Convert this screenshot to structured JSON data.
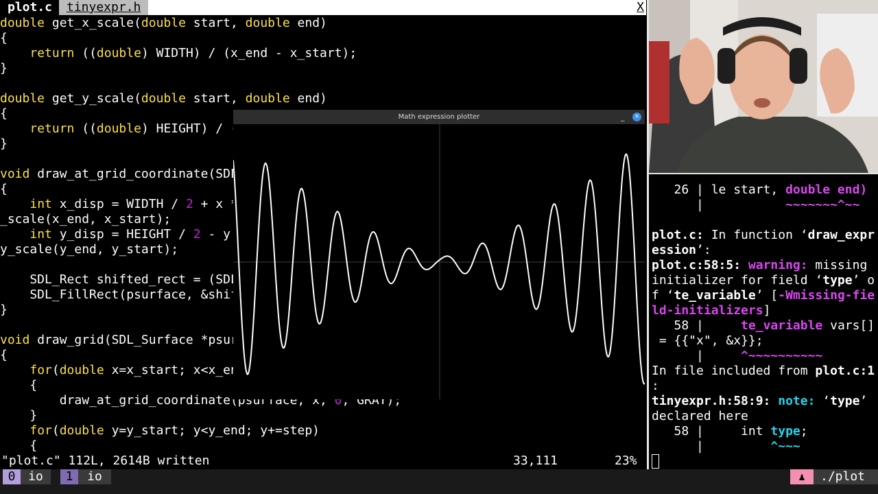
{
  "vim": {
    "tabs": [
      "plot.c",
      "tinyexpr.h"
    ],
    "close_label": "X",
    "code_lines": [
      [
        {
          "t": "double",
          "c": "kt"
        },
        {
          "t": " get_x_scale("
        },
        {
          "t": "double",
          "c": "kt"
        },
        {
          "t": " start, "
        },
        {
          "t": "double",
          "c": "kt"
        },
        {
          "t": " end)"
        }
      ],
      [
        {
          "t": "{"
        }
      ],
      [
        {
          "t": "    "
        },
        {
          "t": "return",
          "c": "kt"
        },
        {
          "t": " (("
        },
        {
          "t": "double",
          "c": "kt"
        },
        {
          "t": ") WIDTH) / (x_end - x_start);"
        }
      ],
      [
        {
          "t": "}"
        }
      ],
      [],
      [
        {
          "t": "double",
          "c": "kt"
        },
        {
          "t": " get_y_scale("
        },
        {
          "t": "double",
          "c": "kt"
        },
        {
          "t": " start, "
        },
        {
          "t": "double",
          "c": "kt"
        },
        {
          "t": " end)"
        }
      ],
      [
        {
          "t": "{"
        }
      ],
      [
        {
          "t": "    "
        },
        {
          "t": "return",
          "c": "kt"
        },
        {
          "t": " (("
        },
        {
          "t": "double",
          "c": "kt"
        },
        {
          "t": ") HEIGHT) / ("
        }
      ],
      [
        {
          "t": "}"
        }
      ],
      [],
      [
        {
          "t": "void",
          "c": "kt"
        },
        {
          "t": " draw_at_grid_coordinate(SDL"
        }
      ],
      [
        {
          "t": "{"
        }
      ],
      [
        {
          "t": "    "
        },
        {
          "t": "int",
          "c": "kt"
        },
        {
          "t": " x_disp = WIDTH / "
        },
        {
          "t": "2",
          "c": "kw"
        },
        {
          "t": " + x *"
        }
      ],
      [
        {
          "t": "_scale(x_end, x_start);"
        }
      ],
      [
        {
          "t": "    "
        },
        {
          "t": "int",
          "c": "kt"
        },
        {
          "t": " y_disp = HEIGHT / "
        },
        {
          "t": "2",
          "c": "kw"
        },
        {
          "t": " - y"
        }
      ],
      [
        {
          "t": "y_scale(y_end, y_start);"
        }
      ],
      [],
      [
        {
          "t": "    SDL_Rect shifted_rect = (SDL"
        }
      ],
      [
        {
          "t": "    SDL_FillRect(psurface, &shif"
        }
      ],
      [
        {
          "t": "}"
        }
      ],
      [],
      [
        {
          "t": "void",
          "c": "kt"
        },
        {
          "t": " draw_grid(SDL_Surface *psur"
        }
      ],
      [
        {
          "t": "{"
        }
      ],
      [
        {
          "t": "    "
        },
        {
          "t": "for",
          "c": "kt"
        },
        {
          "t": "("
        },
        {
          "t": "double",
          "c": "kt"
        },
        {
          "t": " x=x_start; x<x_en"
        }
      ],
      [
        {
          "t": "    {"
        }
      ],
      [
        {
          "t": "        draw_at_grid_coordinate(psurface, x, "
        },
        {
          "t": "0",
          "c": "kw"
        },
        {
          "t": ", GRAY);"
        }
      ],
      [
        {
          "t": "    }"
        }
      ],
      [
        {
          "t": "    "
        },
        {
          "t": "for",
          "c": "kt"
        },
        {
          "t": "("
        },
        {
          "t": "double",
          "c": "kt"
        },
        {
          "t": " y=y_start; y<y_end; y+=step)"
        }
      ],
      [
        {
          "t": "    {"
        }
      ]
    ],
    "status_message": "\"plot.c\" 112L, 2614B written",
    "ruler": "33,111",
    "percent": "23%"
  },
  "plotter": {
    "title": "Math expression plotter",
    "minimize_label": "_",
    "close_label": "×"
  },
  "terminal": {
    "lines": [
      [
        {
          "t": "   26 | le start, "
        },
        {
          "t": "double end)",
          "c": "mag"
        }
      ],
      [
        {
          "t": "      |           "
        },
        {
          "t": "~~~~~~~^~~",
          "c": "mag"
        }
      ],
      [],
      [
        {
          "t": "plot.c:",
          "c": "b"
        },
        {
          "t": " In function ‘"
        },
        {
          "t": "draw_expr",
          "c": "b"
        }
      ],
      [
        {
          "t": "ession",
          "c": "b"
        },
        {
          "t": "’:"
        }
      ],
      [
        {
          "t": "plot.c:58:5:",
          "c": "b"
        },
        {
          "t": " "
        },
        {
          "t": "warning:",
          "c": "mag"
        },
        {
          "t": " missing"
        }
      ],
      [
        {
          "t": "initializer for field ‘"
        },
        {
          "t": "type",
          "c": "b"
        },
        {
          "t": "’ o"
        }
      ],
      [
        {
          "t": "f ‘"
        },
        {
          "t": "te_variable",
          "c": "b"
        },
        {
          "t": "’ ["
        },
        {
          "t": "-Wmissing-fie",
          "c": "mag"
        }
      ],
      [
        {
          "t": "ld-initializers",
          "c": "mag"
        },
        {
          "t": "]"
        }
      ],
      [
        {
          "t": "   58 |     "
        },
        {
          "t": "te_variable",
          "c": "mag"
        },
        {
          "t": " vars[]"
        }
      ],
      [
        {
          "t": " = {{\"x\", &x}};"
        }
      ],
      [
        {
          "t": "      |     "
        },
        {
          "t": "^~~~~~~~~~~",
          "c": "mag"
        }
      ],
      [
        {
          "t": "In file included from "
        },
        {
          "t": "plot.c:1",
          "c": "b"
        }
      ],
      [
        {
          "t": ":"
        }
      ],
      [
        {
          "t": "tinyexpr.h:58:9:",
          "c": "b"
        },
        {
          "t": " "
        },
        {
          "t": "note:",
          "c": "cyan"
        },
        {
          "t": " ‘"
        },
        {
          "t": "type",
          "c": "b"
        },
        {
          "t": "’"
        }
      ],
      [
        {
          "t": "declared here"
        }
      ],
      [
        {
          "t": "   58 |     int "
        },
        {
          "t": "type",
          "c": "cyan"
        },
        {
          "t": ";"
        }
      ],
      [
        {
          "t": "      |         "
        },
        {
          "t": "^~~~",
          "c": "cyan"
        }
      ]
    ]
  },
  "tmux": {
    "windows": [
      {
        "index": "0",
        "name": "io"
      },
      {
        "index": "1",
        "name": "io"
      }
    ],
    "session_icon": "person-icon",
    "session_label": "./plot"
  },
  "colors": {
    "keyword_yellow": "#fde047",
    "number_magenta": "#c026d3",
    "warning_magenta": "#d946ef",
    "note_cyan": "#22d3ee",
    "tmux_active_purple": "#b39ddb",
    "tmux_pink": "#f48fb1"
  }
}
